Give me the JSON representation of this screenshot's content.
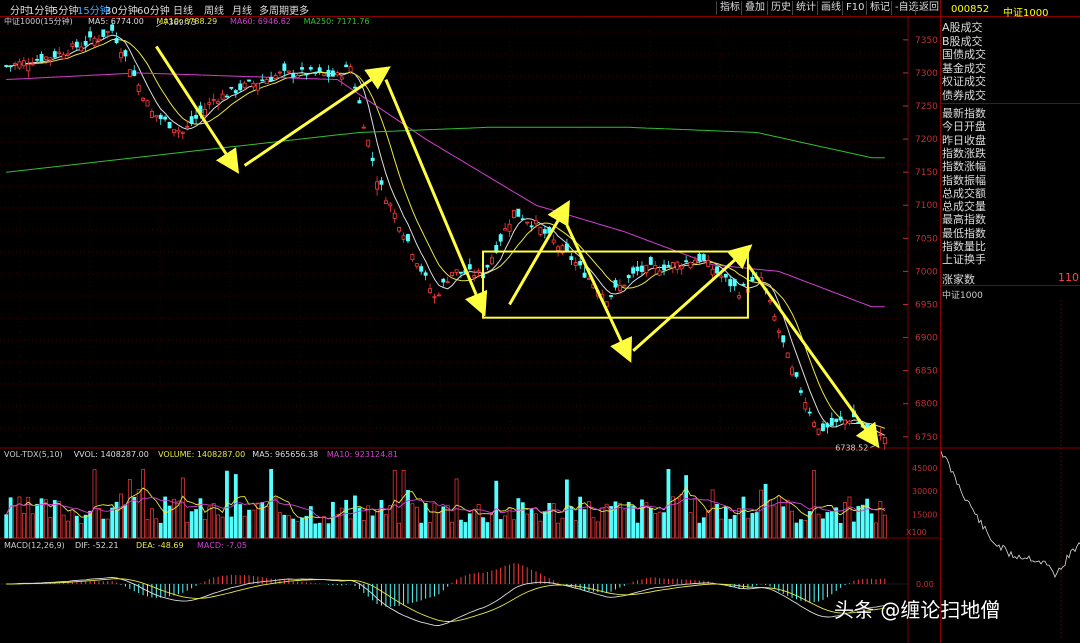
{
  "toolbar": {
    "periods": [
      "分时",
      "1分钟",
      "5分钟",
      "15分钟",
      "30分钟",
      "60分钟",
      "日线",
      "周线",
      "月线",
      "多周期",
      "更多"
    ],
    "active_period": "15分钟",
    "buttons": [
      "指标",
      "叠加",
      "历史",
      "统计",
      "画线",
      "F10",
      "标记",
      "-自选",
      "返回"
    ]
  },
  "main_panel": {
    "title": "中证1000(15分钟)",
    "ma_labels": [
      {
        "text": "MA5: 6774.00",
        "color": "#dddddd"
      },
      {
        "text": "MA10: 6788.29",
        "color": "#e8e840"
      },
      {
        "text": "MA60: 6946.62",
        "color": "#d040d0"
      },
      {
        "text": "MA250: 7171.76",
        "color": "#30c030"
      }
    ],
    "high_marker": "7369.73",
    "low_marker": "6738.52"
  },
  "vol_panel": {
    "labels": [
      {
        "text": "VOL-TDX(5,10)",
        "color": "#cccccc"
      },
      {
        "text": "VVOL: 1408287.00",
        "color": "#dddddd"
      },
      {
        "text": "VOLUME: 1408287.00",
        "color": "#e8e840"
      },
      {
        "text": "MA5: 965656.38",
        "color": "#dddddd"
      },
      {
        "text": "MA10: 923124.81",
        "color": "#d040d0"
      }
    ],
    "x100": "X100"
  },
  "macd_panel": {
    "labels": [
      {
        "text": "MACD(12,26,9)",
        "color": "#cccccc"
      },
      {
        "text": "DIF: -52.21",
        "color": "#dddddd"
      },
      {
        "text": "DEA: -48.69",
        "color": "#e8e840"
      },
      {
        "text": "MACD: -7.05",
        "color": "#d040d0"
      }
    ]
  },
  "side_panel": {
    "code": "000852",
    "name": "中证1000",
    "menu_top": [
      "A股成交",
      "B股成交",
      "国债成交",
      "基金成交",
      "权证成交",
      "债券成交"
    ],
    "menu_fields": [
      "最新指数",
      "今日开盘",
      "昨日收盘",
      "指数涨跌",
      "指数涨幅",
      "指数振幅",
      "总成交额",
      "总成交量",
      "最高指数",
      "最低指数",
      "指数量比",
      "上证换手"
    ],
    "zhangjia_label": "涨家数",
    "zhangjia_value": "110",
    "mini_chart_label": "中证1000"
  },
  "watermark": "头条 @缠论扫地僧",
  "colors": {
    "up": "#ff3c3c",
    "down": "#54ffff",
    "grid": "#800000",
    "axis_text": "#c03030",
    "annot": "#ffff40"
  },
  "chart_data": [
    {
      "type": "candlestick",
      "title": "中证1000(15分钟)",
      "y_ticks": [
        6750,
        6800,
        6850,
        6900,
        6950,
        7000,
        7050,
        7100,
        7150,
        7200,
        7250,
        7300,
        7350
      ],
      "ylim": [
        6730,
        7380
      ],
      "close_path": [
        [
          0,
          7310
        ],
        [
          10,
          7325
        ],
        [
          18,
          7345
        ],
        [
          24,
          7365
        ],
        [
          33,
          7240
        ],
        [
          40,
          7210
        ],
        [
          47,
          7260
        ],
        [
          54,
          7280
        ],
        [
          62,
          7298
        ],
        [
          68,
          7300
        ],
        [
          75,
          7295
        ],
        [
          78,
          7310
        ],
        [
          84,
          7140
        ],
        [
          90,
          7060
        ],
        [
          97,
          6960
        ],
        [
          101,
          7000
        ],
        [
          108,
          6995
        ],
        [
          115,
          7090
        ],
        [
          120,
          7070
        ],
        [
          128,
          7020
        ],
        [
          136,
          6960
        ],
        [
          143,
          7000
        ],
        [
          151,
          7010
        ],
        [
          157,
          7020
        ],
        [
          159,
          7010
        ],
        [
          166,
          6970
        ],
        [
          171,
          6990
        ],
        [
          178,
          6850
        ],
        [
          184,
          6760
        ],
        [
          192,
          6780
        ],
        [
          196,
          6750
        ]
      ],
      "candle_count": 200,
      "ma_series": [
        {
          "name": "MA5",
          "color": "#dddddd",
          "last": 6774.0
        },
        {
          "name": "MA10",
          "color": "#e8e840",
          "last": 6788.29
        },
        {
          "name": "MA60",
          "color": "#d040d0",
          "path": [
            [
              0,
              7290
            ],
            [
              30,
              7300
            ],
            [
              75,
              7290
            ],
            [
              95,
              7200
            ],
            [
              120,
              7100
            ],
            [
              140,
              7060
            ],
            [
              160,
              7010
            ],
            [
              175,
              7000
            ],
            [
              196,
              6946.62
            ]
          ]
        },
        {
          "name": "MA250",
          "color": "#30c030",
          "path": [
            [
              0,
              7150
            ],
            [
              40,
              7180
            ],
            [
              80,
              7210
            ],
            [
              110,
              7218
            ],
            [
              140,
              7218
            ],
            [
              170,
              7210
            ],
            [
              196,
              7171.76
            ]
          ]
        }
      ],
      "annotations": {
        "arrows": [
          [
            [
              34,
              7340
            ],
            [
              52,
              7155
            ]
          ],
          [
            [
              54,
              7160
            ],
            [
              86,
              7305
            ]
          ],
          [
            [
              86,
              7290
            ],
            [
              108,
              6940
            ]
          ],
          [
            [
              114,
              6950
            ],
            [
              127,
              7100
            ]
          ],
          [
            [
              127,
              7070
            ],
            [
              141,
              6870
            ]
          ],
          [
            [
              142,
              6880
            ],
            [
              168,
              7035
            ]
          ],
          [
            [
              168,
              7010
            ],
            [
              197,
              6740
            ]
          ]
        ],
        "box": {
          "x": [
            108,
            168
          ],
          "y": [
            6930,
            7030
          ]
        }
      },
      "high": {
        "x": 34,
        "value": 7369.73
      },
      "low": {
        "x": 198,
        "value": 6738.52
      }
    },
    {
      "type": "bar",
      "title": "VOL-TDX(5,10)",
      "y_ticks": [
        15000,
        30000,
        45000
      ],
      "ylim": [
        0,
        50000
      ],
      "unit_label": "X100",
      "values_last": {
        "VOLUME": 1408287.0,
        "MA5": 965656.38,
        "MA10": 923124.81
      }
    },
    {
      "type": "bar",
      "title": "MACD(12,26,9)",
      "y_ticks": [
        0.0
      ],
      "series": [
        {
          "name": "DIF",
          "color": "#dddddd",
          "last": -52.21
        },
        {
          "name": "DEA",
          "color": "#e8e840",
          "last": -48.69
        },
        {
          "name": "MACD",
          "color": "#d040d0",
          "last": -7.05
        }
      ]
    }
  ]
}
